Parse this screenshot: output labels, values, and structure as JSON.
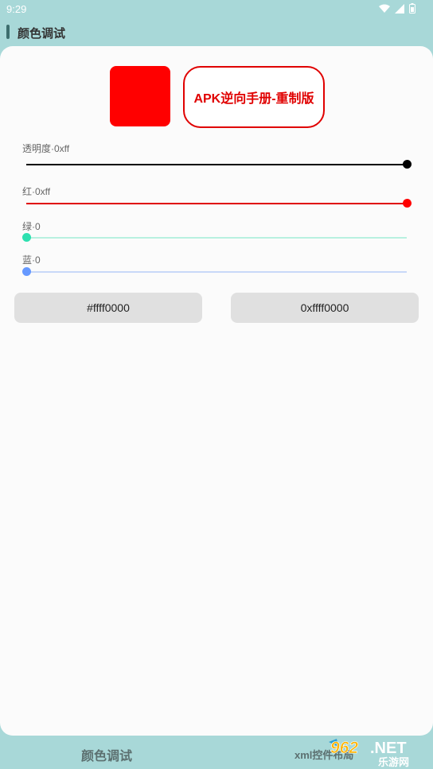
{
  "status_bar": {
    "time": "9:29"
  },
  "header": {
    "title": "颜色调试"
  },
  "preview": {
    "swatch_color": "#ff0000",
    "label_text": "APK逆向手册-重制版",
    "label_color": "#e00000"
  },
  "sliders": [
    {
      "label": "透明度·0xff",
      "value": 255,
      "max": 255,
      "color": "#000000",
      "track": "#000000"
    },
    {
      "label": "红·0xff",
      "value": 255,
      "max": 255,
      "color": "#ff0000",
      "track": "#e00000"
    },
    {
      "label": "绿·0",
      "value": 0,
      "max": 255,
      "color": "#2ee0b0",
      "track": "#b8f0e0"
    },
    {
      "label": "蓝·0",
      "value": 0,
      "max": 255,
      "color": "#6699ff",
      "track": "#c8d8f8"
    }
  ],
  "buttons": {
    "hex_label": "#ffff0000",
    "int_label": "0xffff0000"
  },
  "bottom_nav": {
    "tab1": "颜色调试",
    "tab2": "xml控件布局"
  },
  "watermark": {
    "digits": "962",
    "suffix": ".NET",
    "cn": "乐游网"
  }
}
